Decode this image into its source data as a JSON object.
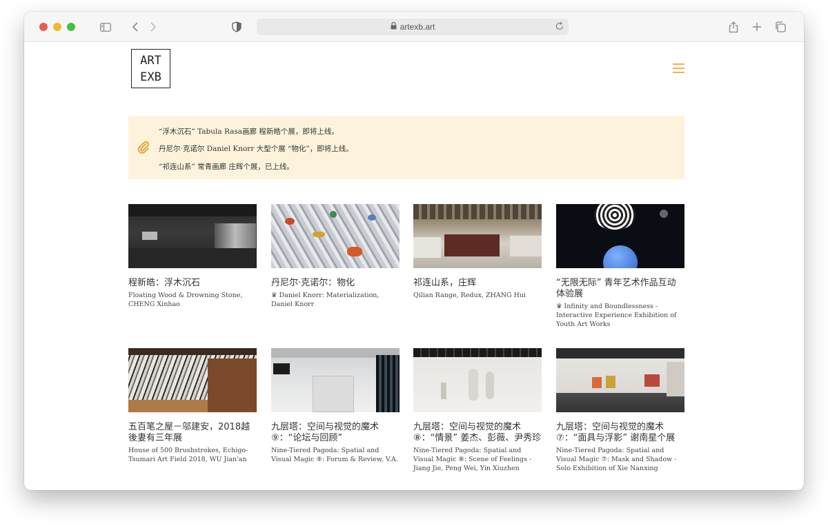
{
  "browser": {
    "url": "artexb.art",
    "icons": [
      "sidebar-icon",
      "chevron-left-icon",
      "chevron-right-icon",
      "shield-icon",
      "lock-icon",
      "reload-icon",
      "share-icon",
      "plus-icon",
      "tabs-icon"
    ]
  },
  "site": {
    "logo_line1": "ART",
    "logo_line2": "EXB",
    "accent_color": "#f2b24a",
    "notice_bg": "#fdf3dc"
  },
  "notices": [
    "“浮木沉石” Tabula Rasa画廊 程新皓个展，即将上线。",
    "丹尼尔·克诺尔 Daniel Knorr 大型个展 “物化”，即将上线。",
    "“祁连山系” 常青画廊 庄辉个展，已上线。"
  ],
  "exhibitions": [
    {
      "title": "程新皓：浮木沉石",
      "subtitle": "Floating Wood & Drowning Stone, CHENG Xinhao"
    },
    {
      "title": "丹尼尔·克诺尔：物化",
      "subtitle": "♛ Daniel Knorr: Materialization, Daniel Knorr"
    },
    {
      "title": "祁连山系，庄辉",
      "subtitle": "Qilian Range, Redux, ZHANG Hui"
    },
    {
      "title": "“无限无际” 青年艺术作品互动体验展",
      "subtitle": "♛ Infinity and Boundlessness - Interactive Experience Exhibition of Youth Art Works"
    },
    {
      "title": "五百笔之屋－邬建安，2018越後妻有三年展",
      "subtitle": "House of 500 Brushstrokes, Echigo-Tsumari Art Field 2018, WU Jian'an"
    },
    {
      "title": "九层塔：空间与视觉的魔术⑨：“论坛与回顾”",
      "subtitle": "Nine-Tiered Pagoda: Spatial and Visual Magic ⑨: Forum & Review, V.A."
    },
    {
      "title": "九层塔：空间与视觉的魔术⑧：“情景” 姜杰、彭薇、尹秀珍",
      "subtitle": "Nine-Tiered Pagoda: Spatial and Visual Magic ⑧: Scene of Feelings - Jiang Jie, Peng Wei, Yin Xiuzhen"
    },
    {
      "title": "九层塔：空间与视觉的魔术⑦：“面具与浮影” 谢南星个展",
      "subtitle": "Nine-Tiered Pagoda: Spatial and Visual Magic ⑦: Mask and Shadow - Solo Exhibition of Xie Nanxing"
    }
  ]
}
